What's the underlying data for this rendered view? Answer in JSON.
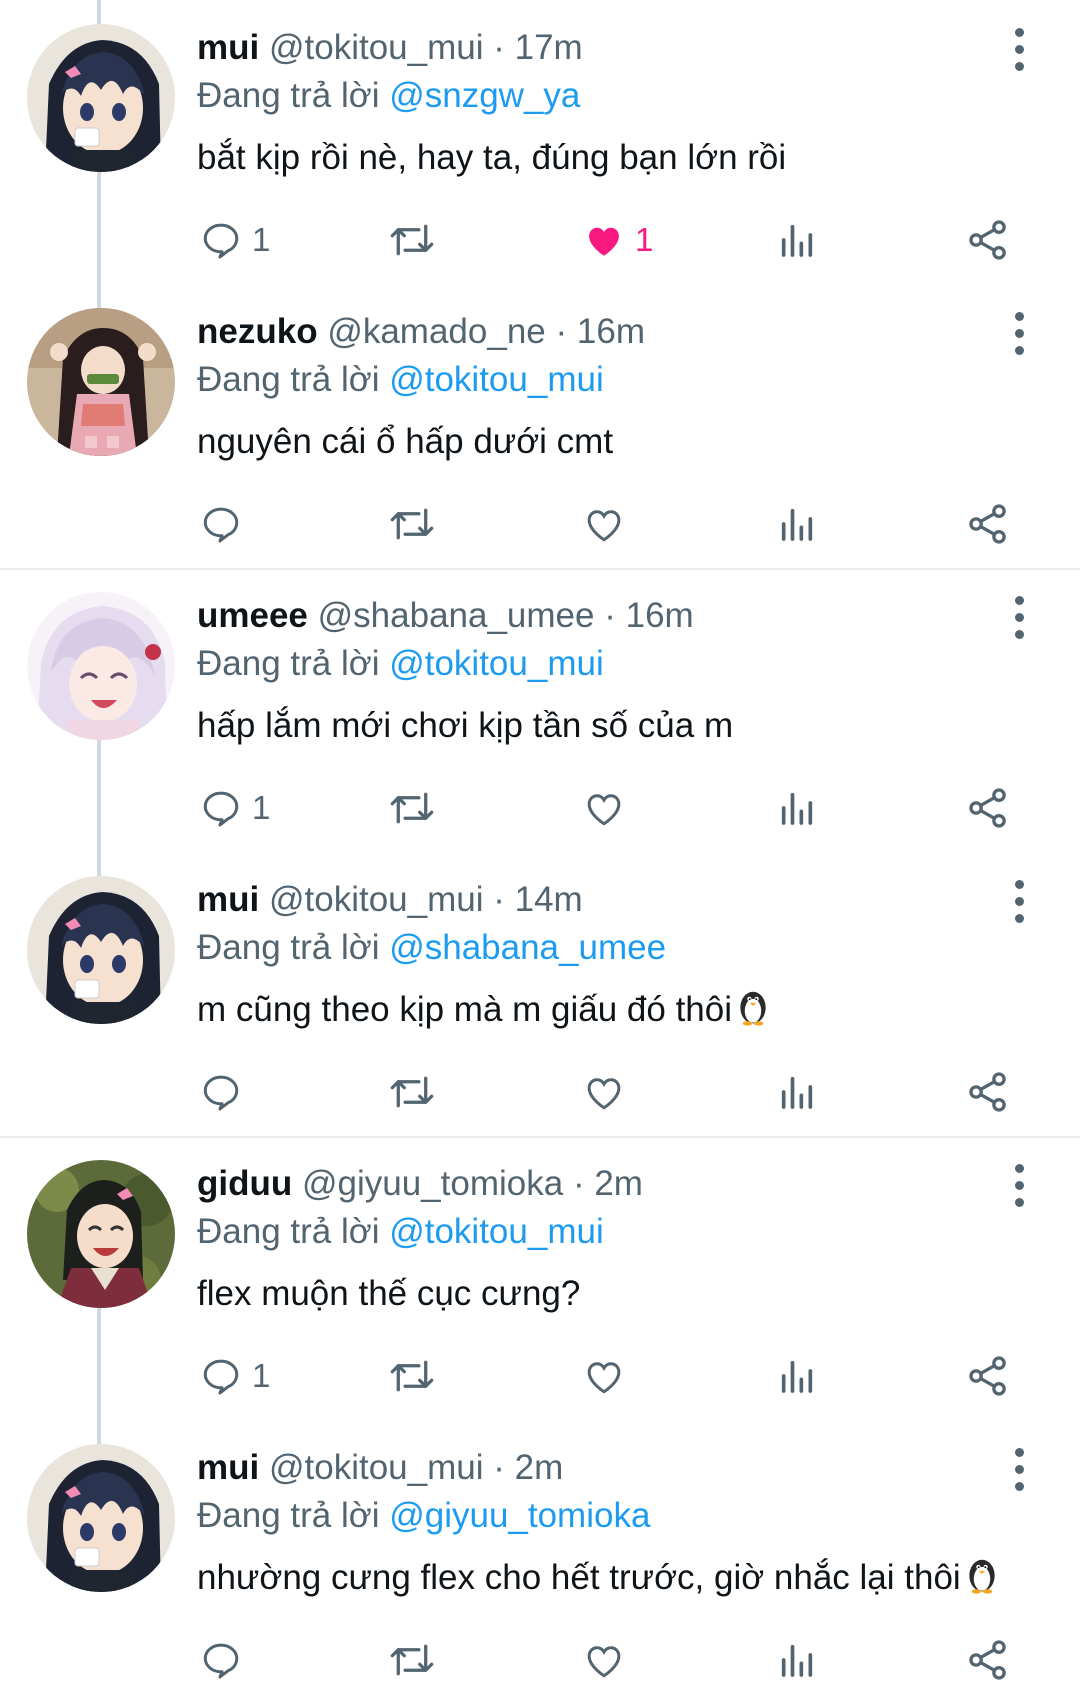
{
  "tweets": [
    {
      "name": "mui",
      "handle": "@tokitou_mui",
      "dot": "·",
      "time": "17m",
      "reply_prefix": "Đang trả lời",
      "reply_to": "@snzgw_ya",
      "text": "bắt kịp rồi nè, hay ta, đúng bạn lớn rồi",
      "reply_count": "1",
      "like_count": "1",
      "liked": true,
      "emoji": ""
    },
    {
      "name": "nezuko",
      "handle": "@kamado_ne",
      "dot": "·",
      "time": "16m",
      "reply_prefix": "Đang trả lời",
      "reply_to": "@tokitou_mui",
      "text": "nguyên cái ổ hấp dưới cmt",
      "reply_count": "",
      "like_count": "",
      "liked": false,
      "emoji": ""
    },
    {
      "name": "umeee",
      "handle": "@shabana_umee",
      "dot": "·",
      "time": "16m",
      "reply_prefix": "Đang trả lời",
      "reply_to": "@tokitou_mui",
      "text": "hấp lắm mới chơi kịp tần số của m",
      "reply_count": "1",
      "like_count": "",
      "liked": false,
      "emoji": ""
    },
    {
      "name": "mui",
      "handle": "@tokitou_mui",
      "dot": "·",
      "time": "14m",
      "reply_prefix": "Đang trả lời",
      "reply_to": "@shabana_umee",
      "text": "m cũng theo kịp mà m giấu đó thôi",
      "reply_count": "",
      "like_count": "",
      "liked": false,
      "emoji": "penguin-emoji"
    },
    {
      "name": "giduu",
      "handle": "@giyuu_tomioka",
      "dot": "·",
      "time": "2m",
      "reply_prefix": "Đang trả lời",
      "reply_to": "@tokitou_mui",
      "text": "flex muộn thế cục cưng?",
      "reply_count": "1",
      "like_count": "",
      "liked": false,
      "emoji": ""
    },
    {
      "name": "mui",
      "handle": "@tokitou_mui",
      "dot": "·",
      "time": "2m",
      "reply_prefix": "Đang trả lời",
      "reply_to": "@giyuu_tomioka",
      "text": "nhường cưng flex cho hết trước, giờ nhắc lại thôi",
      "reply_count": "",
      "like_count": "",
      "liked": false,
      "emoji": "penguin-emoji"
    }
  ],
  "colors": {
    "mention": "#1d9bf0",
    "like_active": "#f91880",
    "secondary_text": "#536471",
    "thread_line": "#cfd9de",
    "divider": "#e6ecf0"
  },
  "icons": [
    "reply-icon",
    "retweet-icon",
    "like-icon",
    "views-icon",
    "share-icon",
    "more-icon",
    "penguin-emoji"
  ]
}
